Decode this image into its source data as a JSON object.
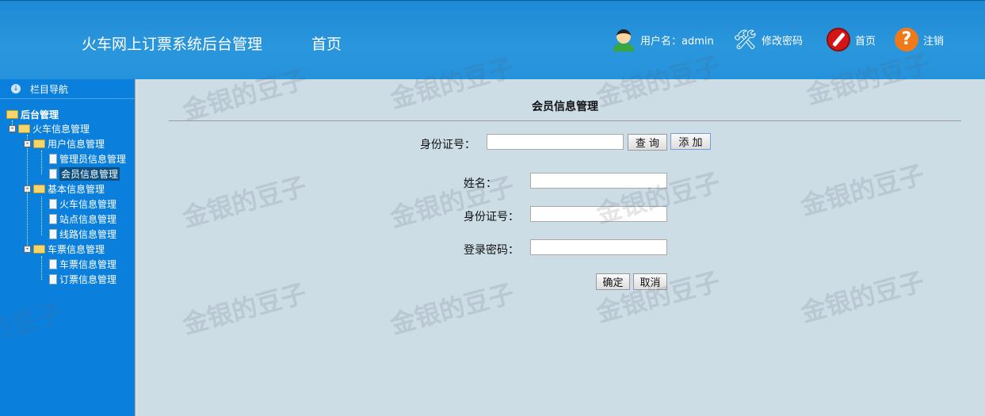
{
  "header": {
    "title": "火车网上订票系统后台管理",
    "home": "首页",
    "user": "用户名：admin",
    "change_password": "修改密码",
    "home_link": "首页",
    "logout": "注销"
  },
  "sidebar": {
    "nav_title": "栏目导航",
    "root": "后台管理",
    "groups": [
      {
        "label": "火车信息管理"
      },
      {
        "label": "用户信息管理",
        "items": [
          "管理员信息管理",
          "会员信息管理"
        ]
      },
      {
        "label": "基本信息管理",
        "items": [
          "火车信息管理",
          "站点信息管理",
          "线路信息管理"
        ]
      },
      {
        "label": "车票信息管理",
        "items": [
          "车票信息管理",
          "订票信息管理"
        ]
      }
    ]
  },
  "main": {
    "title": "会员信息管理",
    "search_label": "身份证号：",
    "search_value": "",
    "query": "查 询",
    "add": "添 加",
    "form": {
      "name_label": "姓名：",
      "id_label": "身份证号：",
      "password_label": "登录密码：",
      "confirm": "确定",
      "cancel": "取消"
    }
  },
  "watermark": "金银的豆子"
}
